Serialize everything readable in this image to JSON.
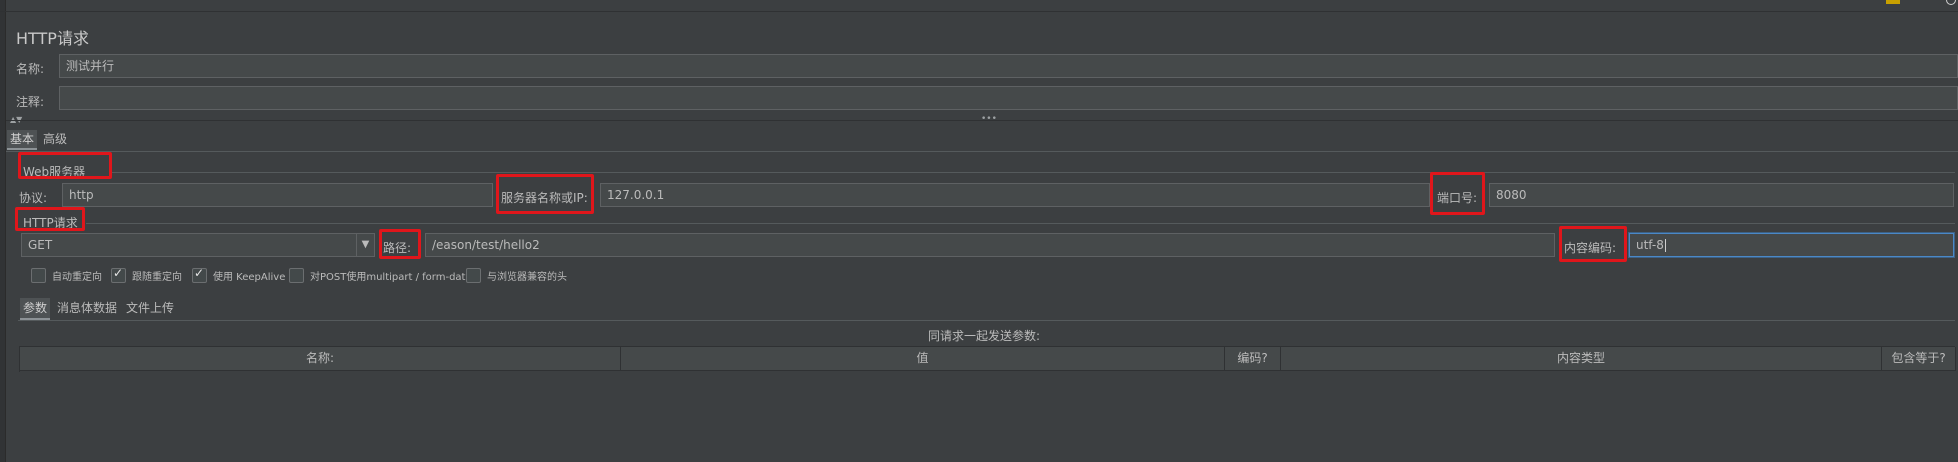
{
  "panel": {
    "title": "HTTP请求"
  },
  "form": {
    "name_label": "名称:",
    "name_value": "测试并行",
    "comment_label": "注释:",
    "comment_value": ""
  },
  "splitter": {
    "arrows": "▲▼",
    "handle": "•••"
  },
  "tabs": {
    "basic": "基本",
    "advanced": "高级"
  },
  "web_server": {
    "section_title": "Web服务器",
    "protocol_label": "协议:",
    "protocol_value": "http",
    "server_label": "服务器名称或IP:",
    "server_value": "127.0.0.1",
    "port_label": "端口号:",
    "port_value": "8080"
  },
  "http_request": {
    "section_title": "HTTP请求",
    "method_value": "GET",
    "path_label": "路径:",
    "path_value": "/eason/test/hello2",
    "encoding_label": "内容编码:",
    "encoding_value": "utf-8"
  },
  "options": [
    {
      "label": "自动重定向",
      "checked": false
    },
    {
      "label": "跟随重定向",
      "checked": true
    },
    {
      "label": "使用 KeepAlive",
      "checked": true
    },
    {
      "label": "对POST使用multipart / form-data",
      "checked": false
    },
    {
      "label": "与浏览器兼容的头",
      "checked": false
    }
  ],
  "subtabs": {
    "params": "参数",
    "body": "消息体数据",
    "files": "文件上传"
  },
  "params_table": {
    "caption": "同请求一起发送参数:",
    "columns": [
      "名称:",
      "值",
      "编码?",
      "内容类型",
      "包含等于?"
    ]
  },
  "colors": {
    "highlight": "#e0161b",
    "focus": "#4a88c7",
    "background": "#3c3f41"
  }
}
